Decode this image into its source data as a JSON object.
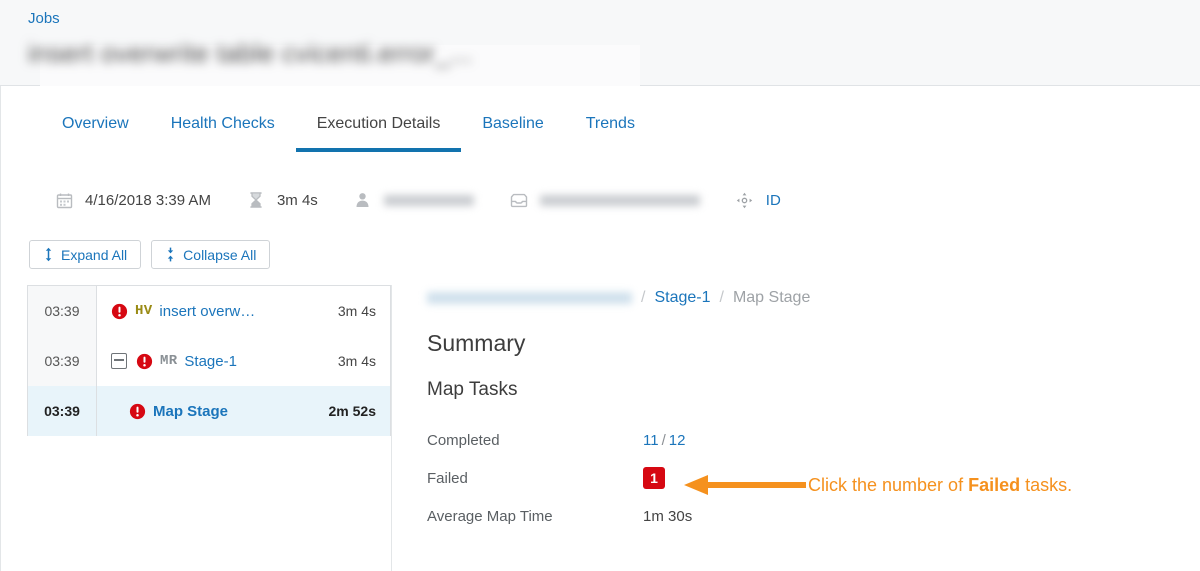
{
  "header": {
    "breadcrumb_top": "Jobs",
    "job_title": "insert overwrite table cvicenti.error_...",
    "job_title_redacted": true
  },
  "tabs": [
    {
      "label": "Overview",
      "active": false
    },
    {
      "label": "Health Checks",
      "active": false
    },
    {
      "label": "Execution Details",
      "active": true
    },
    {
      "label": "Baseline",
      "active": false
    },
    {
      "label": "Trends",
      "active": false
    }
  ],
  "meta": {
    "date_icon": "calendar-icon",
    "date": "4/16/2018 3:39 AM",
    "duration_icon": "hourglass-icon",
    "duration": "3m 4s",
    "user_icon": "person-icon",
    "user": "",
    "queue_icon": "inbox-icon",
    "queue": "",
    "id_icon": "move-crosshair-icon",
    "id_label": "ID"
  },
  "toolbar": {
    "expand_all": "Expand All",
    "collapse_all": "Collapse All"
  },
  "tree": {
    "rows": [
      {
        "time": "03:39",
        "type": "HV",
        "type_class": "hv",
        "name": "insert overw…",
        "duration": "3m 4s",
        "has_collapse": false,
        "selected": false
      },
      {
        "time": "03:39",
        "type": "MR",
        "type_class": "mr",
        "name": "Stage-1",
        "duration": "3m 4s",
        "has_collapse": true,
        "selected": false
      },
      {
        "time": "03:39",
        "type": "",
        "type_class": "",
        "name": "Map Stage",
        "duration": "2m 52s",
        "has_collapse": false,
        "selected": true
      }
    ]
  },
  "detail": {
    "breadcrumb": {
      "root": "insert overwrite table cvicenti...",
      "root_redacted": true,
      "stage": "Stage-1",
      "current": "Map Stage",
      "separator": "/"
    },
    "summary_heading": "Summary",
    "map_tasks_heading": "Map Tasks",
    "stats": [
      {
        "label": "Completed",
        "value": "11",
        "value2": "12",
        "kind": "fraction"
      },
      {
        "label": "Failed",
        "value": "1",
        "kind": "badge"
      },
      {
        "label": "Average Map Time",
        "value": "1m 30s",
        "kind": "text"
      }
    ]
  },
  "annotation": {
    "text_before": "Click the number of ",
    "text_bold": "Failed",
    "text_after": " tasks.",
    "color": "#f5911e",
    "arrow_icon": "left-arrow-icon"
  },
  "colors": {
    "link": "#1b75bb",
    "active_tab_underline": "#1273ae",
    "error_red": "#d60812",
    "selected_row_bg": "#e8f4fa",
    "annotation_orange": "#f5911e",
    "hv_olive": "#9a8b15"
  }
}
